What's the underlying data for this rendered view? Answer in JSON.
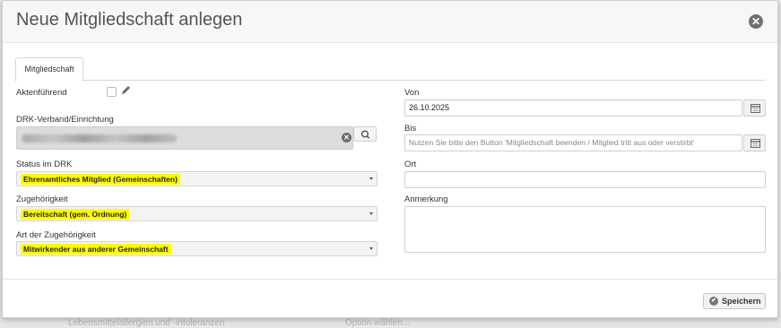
{
  "modal": {
    "title": "Neue Mitgliedschaft anlegen",
    "close_icon": "close-circle-icon"
  },
  "tabs": [
    {
      "label": "Mitgliedschaft",
      "active": true
    }
  ],
  "left": {
    "aktenfuehrend_label": "Aktenführend",
    "aktenfuehrend_checked": false,
    "drk_label": "DRK-Verband/Einrichtung",
    "status_label": "Status im DRK",
    "status_value": "Ehrenamtliches Mitglied (Gemeinschaften)",
    "zugehoerigkeit_label": "Zugehörigkeit",
    "zugehoerigkeit_value": "Bereitschaft (gem. Ordnung)",
    "art_label": "Art der Zugehörigkeit",
    "art_value": "Mitwirkender aus anderer Gemeinschaft"
  },
  "right": {
    "von_label": "Von",
    "von_value": "26.10.2025",
    "bis_label": "Bis",
    "bis_placeholder": "Nutzen Sie bitte den Button 'Mitgliedschaft beenden / Mitglied tritt aus oder verstirbt'",
    "ort_label": "Ort",
    "ort_value": "",
    "anmerkung_label": "Anmerkung",
    "anmerkung_value": ""
  },
  "footer": {
    "save_label": "Speichern"
  },
  "background": {
    "text_left": "Lebensmittelallergien und -intoleranzen",
    "text_right": "Option wählen..."
  },
  "colors": {
    "highlight": "#ffff00",
    "header_bg": "#f7f7f7"
  }
}
